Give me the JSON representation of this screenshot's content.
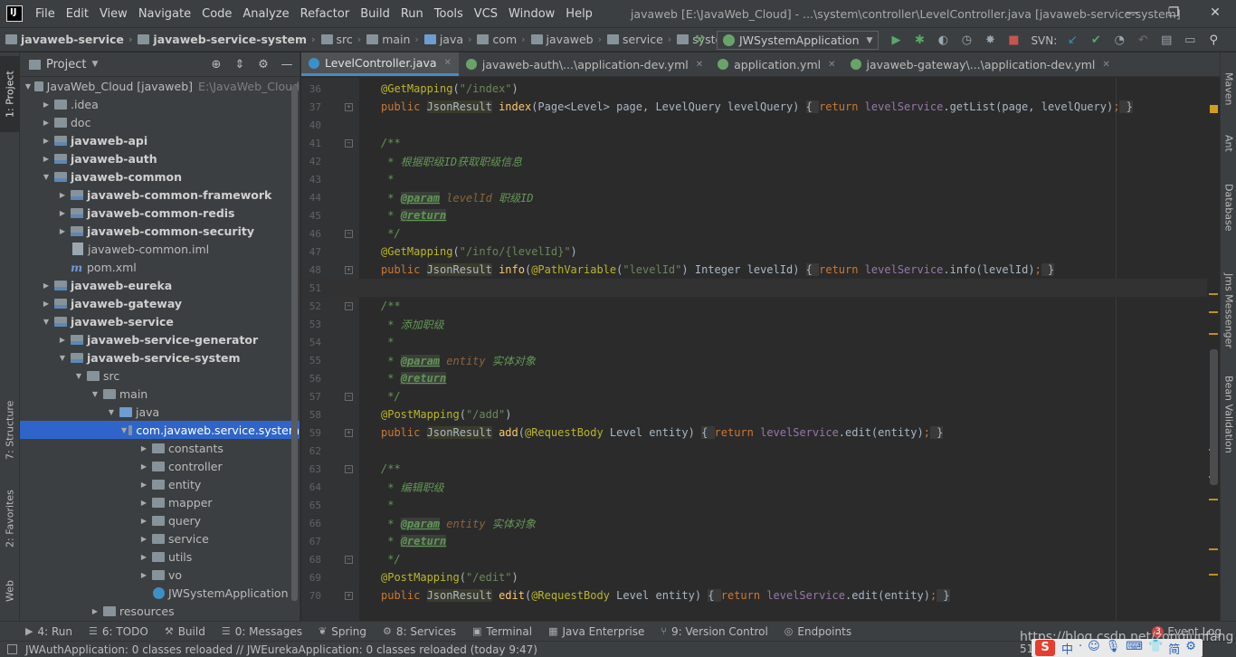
{
  "app": {
    "logo_text": "IJ",
    "menu": [
      "File",
      "Edit",
      "View",
      "Navigate",
      "Code",
      "Analyze",
      "Refactor",
      "Build",
      "Run",
      "Tools",
      "VCS",
      "Window",
      "Help"
    ],
    "window_title": "javaweb [E:\\JavaWeb_Cloud] - ...\\system\\controller\\LevelController.java [javaweb-service-system]",
    "win_controls": [
      "—",
      "❐",
      "✕"
    ]
  },
  "navbar": {
    "breadcrumbs": [
      "javaweb-service",
      "javaweb-service-system",
      "src",
      "main",
      "java",
      "com",
      "javaweb",
      "service",
      "system"
    ],
    "run_config": "JWSystemApplication",
    "svn_label": "SVN:"
  },
  "left_strip": [
    "1: Project",
    "7: Structure",
    "2: Favorites",
    "Web"
  ],
  "project": {
    "title": "Project",
    "tree": [
      {
        "depth": 0,
        "arrow": "▼",
        "icon": "folder",
        "label": "JavaWeb_Cloud [javaweb]",
        "bold": false,
        "extra": "E:\\JavaWeb_Cloud"
      },
      {
        "depth": 1,
        "arrow": "▶",
        "icon": "folder",
        "label": ".idea"
      },
      {
        "depth": 1,
        "arrow": "▶",
        "icon": "folder",
        "label": "doc"
      },
      {
        "depth": 1,
        "arrow": "▶",
        "icon": "module",
        "label": "javaweb-api",
        "bold": true
      },
      {
        "depth": 1,
        "arrow": "▶",
        "icon": "module",
        "label": "javaweb-auth",
        "bold": true
      },
      {
        "depth": 1,
        "arrow": "▼",
        "icon": "module",
        "label": "javaweb-common",
        "bold": true
      },
      {
        "depth": 2,
        "arrow": "▶",
        "icon": "module",
        "label": "javaweb-common-framework",
        "bold": true
      },
      {
        "depth": 2,
        "arrow": "▶",
        "icon": "module",
        "label": "javaweb-common-redis",
        "bold": true
      },
      {
        "depth": 2,
        "arrow": "▶",
        "icon": "module",
        "label": "javaweb-common-security",
        "bold": true
      },
      {
        "depth": 2,
        "arrow": "",
        "icon": "file",
        "label": "javaweb-common.iml"
      },
      {
        "depth": 2,
        "arrow": "",
        "icon": "maven",
        "label": "pom.xml"
      },
      {
        "depth": 1,
        "arrow": "▶",
        "icon": "module",
        "label": "javaweb-eureka",
        "bold": true
      },
      {
        "depth": 1,
        "arrow": "▶",
        "icon": "module",
        "label": "javaweb-gateway",
        "bold": true
      },
      {
        "depth": 1,
        "arrow": "▼",
        "icon": "module",
        "label": "javaweb-service",
        "bold": true
      },
      {
        "depth": 2,
        "arrow": "▶",
        "icon": "module",
        "label": "javaweb-service-generator",
        "bold": true
      },
      {
        "depth": 2,
        "arrow": "▼",
        "icon": "module",
        "label": "javaweb-service-system",
        "bold": true
      },
      {
        "depth": 3,
        "arrow": "▼",
        "icon": "folder",
        "label": "src"
      },
      {
        "depth": 4,
        "arrow": "▼",
        "icon": "folder",
        "label": "main"
      },
      {
        "depth": 5,
        "arrow": "▼",
        "icon": "src",
        "label": "java"
      },
      {
        "depth": 6,
        "arrow": "▼",
        "icon": "pkg",
        "label": "com.javaweb.service.system",
        "selected": true
      },
      {
        "depth": 7,
        "arrow": "▶",
        "icon": "pkg",
        "label": "constants"
      },
      {
        "depth": 7,
        "arrow": "▶",
        "icon": "pkg",
        "label": "controller"
      },
      {
        "depth": 7,
        "arrow": "▶",
        "icon": "pkg",
        "label": "entity"
      },
      {
        "depth": 7,
        "arrow": "▶",
        "icon": "pkg",
        "label": "mapper"
      },
      {
        "depth": 7,
        "arrow": "▶",
        "icon": "pkg",
        "label": "query"
      },
      {
        "depth": 7,
        "arrow": "▶",
        "icon": "pkg",
        "label": "service"
      },
      {
        "depth": 7,
        "arrow": "▶",
        "icon": "pkg",
        "label": "utils"
      },
      {
        "depth": 7,
        "arrow": "▶",
        "icon": "pkg",
        "label": "vo"
      },
      {
        "depth": 7,
        "arrow": "",
        "icon": "class",
        "label": "JWSystemApplication"
      },
      {
        "depth": 4,
        "arrow": "▶",
        "icon": "folder",
        "label": "resources"
      }
    ]
  },
  "editor": {
    "tabs": [
      {
        "label": "LevelController.java",
        "icon": "class-icon",
        "active": true
      },
      {
        "label": "javaweb-auth\\...\\application-dev.yml",
        "icon": "yml-icon"
      },
      {
        "label": "application.yml",
        "icon": "yml-icon"
      },
      {
        "label": "javaweb-gateway\\...\\application-dev.yml",
        "icon": "yml-icon"
      }
    ],
    "lines": [
      {
        "n": "36",
        "fold": "",
        "html": "<span class=\"a\">@GetMapping</span>(<span class=\"s\">\"/index\"</span>)"
      },
      {
        "n": "37",
        "fold": "+",
        "html": "<span class=\"k\">public </span><span class=\"hl\">JsonResult</span> <span class=\"m\">index</span>(Page&lt;Level&gt; page, LevelQuery levelQuery) <span class=\"brk\">{ </span><span class=\"k\">return </span><span class=\"f\">levelService</span>.getList(page, levelQuery)<span class=\"k\">;</span><span class=\"brk\"> }</span>"
      },
      {
        "n": "40",
        "fold": "",
        "html": ""
      },
      {
        "n": "41",
        "fold": "-",
        "html": "<span class=\"c\">/**</span>"
      },
      {
        "n": "42",
        "fold": "",
        "html": "<span class=\"c\"> * 根据职级ID获取职级信息</span>"
      },
      {
        "n": "43",
        "fold": "",
        "html": "<span class=\"c\"> *</span>"
      },
      {
        "n": "44",
        "fold": "",
        "html": "<span class=\"c\"> * </span><span class=\"ct\">@param</span><span class=\"c\"> </span><span class=\"cp\">levelId</span><span class=\"c\"> 职级ID</span>"
      },
      {
        "n": "45",
        "fold": "",
        "html": "<span class=\"c\"> * </span><span class=\"ct\">@return</span>"
      },
      {
        "n": "46",
        "fold": "-",
        "html": "<span class=\"c\"> */</span>"
      },
      {
        "n": "47",
        "fold": "",
        "html": "<span class=\"a\">@GetMapping</span>(<span class=\"s\">\"/info/{levelId}\"</span>)"
      },
      {
        "n": "48",
        "fold": "+",
        "html": "<span class=\"k\">public </span><span class=\"hl\">JsonResult</span> <span class=\"m\">info</span>(<span class=\"a\">@PathVariable</span>(<span class=\"s\">\"levelId\"</span>) Integer levelId) <span class=\"brk\">{ </span><span class=\"k\">return </span><span class=\"f\">levelService</span>.info(levelId)<span class=\"k\">;</span><span class=\"brk\"> }</span>"
      },
      {
        "n": "51",
        "fold": "",
        "html": "",
        "caret": true
      },
      {
        "n": "52",
        "fold": "-",
        "html": "<span class=\"c\">/**</span>"
      },
      {
        "n": "53",
        "fold": "",
        "html": "<span class=\"c\"> * 添加职级</span>"
      },
      {
        "n": "54",
        "fold": "",
        "html": "<span class=\"c\"> *</span>"
      },
      {
        "n": "55",
        "fold": "",
        "html": "<span class=\"c\"> * </span><span class=\"ct\">@param</span><span class=\"c\"> </span><span class=\"cp\">entity</span><span class=\"c\"> 实体对象</span>"
      },
      {
        "n": "56",
        "fold": "",
        "html": "<span class=\"c\"> * </span><span class=\"ct\">@return</span>"
      },
      {
        "n": "57",
        "fold": "-",
        "html": "<span class=\"c\"> */</span>"
      },
      {
        "n": "58",
        "fold": "",
        "html": "<span class=\"a\">@PostMapping</span>(<span class=\"s\">\"/add\"</span>)"
      },
      {
        "n": "59",
        "fold": "+",
        "html": "<span class=\"k\">public </span><span class=\"hl\">JsonResult</span> <span class=\"m\">add</span>(<span class=\"a\">@RequestBody</span> Level entity) <span class=\"brk\">{ </span><span class=\"k\">return </span><span class=\"f\">levelService</span>.edit(entity)<span class=\"k\">;</span><span class=\"brk\"> }</span>"
      },
      {
        "n": "62",
        "fold": "",
        "html": ""
      },
      {
        "n": "63",
        "fold": "-",
        "html": "<span class=\"c\">/**</span>"
      },
      {
        "n": "64",
        "fold": "",
        "html": "<span class=\"c\"> * 编辑职级</span>"
      },
      {
        "n": "65",
        "fold": "",
        "html": "<span class=\"c\"> *</span>"
      },
      {
        "n": "66",
        "fold": "",
        "html": "<span class=\"c\"> * </span><span class=\"ct\">@param</span><span class=\"c\"> </span><span class=\"cp\">entity</span><span class=\"c\"> 实体对象</span>"
      },
      {
        "n": "67",
        "fold": "",
        "html": "<span class=\"c\"> * </span><span class=\"ct\">@return</span>"
      },
      {
        "n": "68",
        "fold": "-",
        "html": "<span class=\"c\"> */</span>"
      },
      {
        "n": "69",
        "fold": "",
        "html": "<span class=\"a\">@PostMapping</span>(<span class=\"s\">\"/edit\"</span>)"
      },
      {
        "n": "70",
        "fold": "+",
        "html": "<span class=\"k\">public </span><span class=\"hl\">JsonResult</span> <span class=\"m\">edit</span>(<span class=\"a\">@RequestBody</span> Level entity) <span class=\"brk\">{ </span><span class=\"k\">return </span><span class=\"f\">levelService</span>.edit(entity)<span class=\"k\">;</span><span class=\"brk\"> }</span>"
      }
    ]
  },
  "right_strip": [
    "Maven",
    "Ant",
    "Database",
    "Jms Messenger",
    "Bean Validation"
  ],
  "bottom_tools": [
    {
      "icon": "▶",
      "label": "4: Run"
    },
    {
      "icon": "☰",
      "label": "6: TODO"
    },
    {
      "icon": "⚒",
      "label": "Build"
    },
    {
      "icon": "☰",
      "label": "0: Messages"
    },
    {
      "icon": "❦",
      "label": "Spring"
    },
    {
      "icon": "⚙",
      "label": "8: Services"
    },
    {
      "icon": "▣",
      "label": "Terminal"
    },
    {
      "icon": "▦",
      "label": "Java Enterprise"
    },
    {
      "icon": "⑂",
      "label": "9: Version Control"
    },
    {
      "icon": "◎",
      "label": "Endpoints"
    }
  ],
  "event_log": {
    "count": "3",
    "label": "Event Log"
  },
  "status": {
    "message": "JWAuthApplication: 0 classes reloaded // JWEurekaApplication: 0 classes reloaded (today 9:47)",
    "position": "51"
  },
  "watermark": "https://blog.csdn.net/zongjunfang",
  "ime": {
    "logo": "S",
    "items": [
      "中",
      "·",
      "☺",
      "🎙",
      "⌨",
      "👕",
      "简",
      "⚙"
    ]
  },
  "colors": {
    "selection": "#2f65ca",
    "keyword": "#cc7832",
    "annotation": "#bbb529",
    "string": "#6a8759",
    "doc_comment": "#629755"
  }
}
